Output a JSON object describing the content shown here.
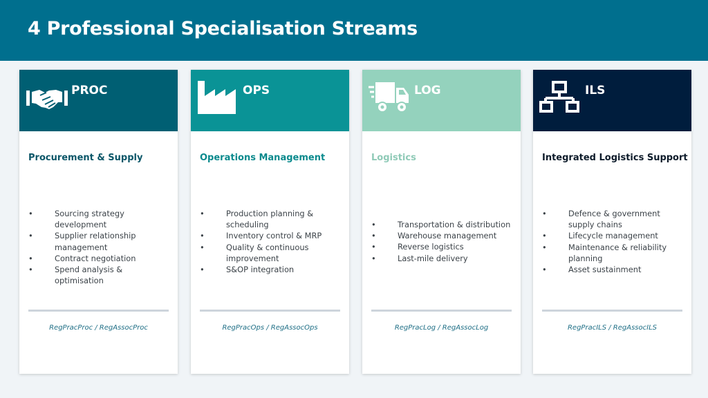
{
  "header": {
    "title": "4 Professional Specialisation Streams"
  },
  "cards": [
    {
      "code": "PROC",
      "icon": "handshake-icon",
      "head_color": "#005f73",
      "title": "Procurement & Supply",
      "title_color": "#0b5668",
      "bullets": [
        "Sourcing strategy development",
        "Supplier relationship management",
        "Contract negotiation",
        "Spend analysis & optimisation"
      ],
      "footer": "RegPracProc / RegAssocProc"
    },
    {
      "code": "OPS",
      "icon": "factory-icon",
      "head_color": "#0a9396",
      "title": "Operations Management",
      "title_color": "#0a8a8d",
      "bullets": [
        "Production planning & scheduling",
        "Inventory control & MRP",
        "Quality & continuous improvement",
        "S&OP integration"
      ],
      "footer": "RegPracOps / RegAssocOps"
    },
    {
      "code": "LOG",
      "icon": "truck-icon",
      "head_color": "#94d2bd",
      "title": "Logistics",
      "title_color": "#8fcab7",
      "bullets": [
        "Transportation & distribution",
        "Warehouse management",
        "Reverse logistics",
        "Last-mile delivery"
      ],
      "footer": "RegPracLog / RegAssocLog"
    },
    {
      "code": "ILS",
      "icon": "network-icon",
      "head_color": "#001d3d",
      "title": "Integrated Logistics Support",
      "title_color": "#0d1b2a",
      "bullets": [
        "Defence & government supply chains",
        "Lifecycle management",
        "Maintenance & reliability planning",
        "Asset sustainment"
      ],
      "footer": "RegPracILS / RegAssocILS"
    }
  ]
}
